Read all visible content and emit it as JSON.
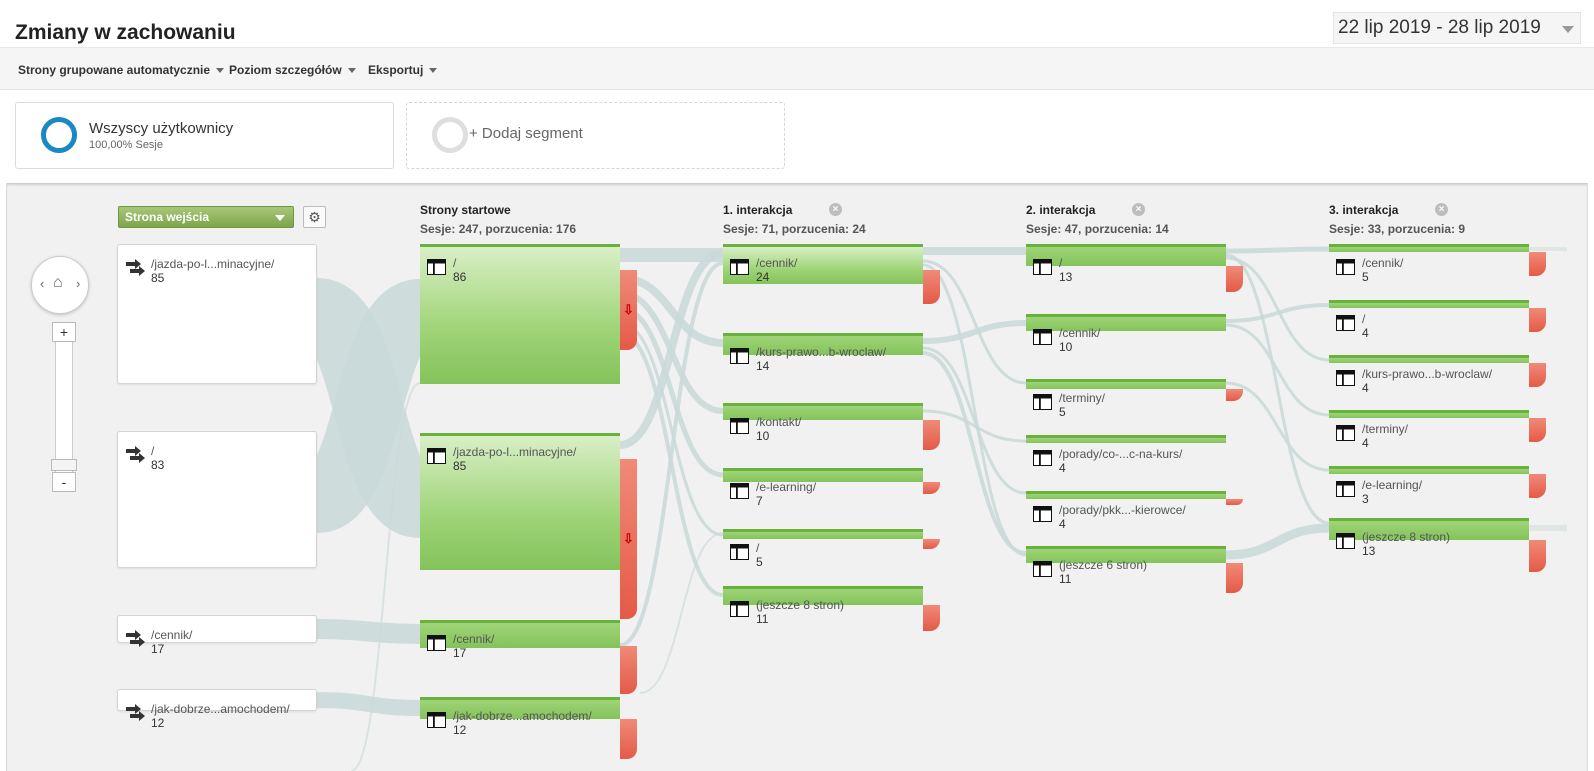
{
  "header": {
    "title": "Zmiany w zachowaniu",
    "date_range": "22 lip 2019 - 28 lip 2019"
  },
  "toolbar": {
    "items": [
      "Strony grupowane automatycznie",
      "Poziom szczegółów",
      "Eksportuj"
    ]
  },
  "segments": {
    "active": {
      "name": "Wszyscy użytkownicy",
      "sub": "100,00% Sesje",
      "color": "#1a88c4"
    },
    "add_label": "+ Dodaj segment"
  },
  "canvas": {
    "dimension_select": "Strona wejścia",
    "nav": {
      "left": "‹",
      "right": "›",
      "home": "⌂"
    },
    "zoom": {
      "plus": "+",
      "minus": "-"
    }
  },
  "columns": [
    {
      "title": "Strony startowe",
      "stats": "Sesje: 247, porzucenia: 176"
    },
    {
      "title": "1. interakcja",
      "stats": "Sesje: 71, porzucenia: 24"
    },
    {
      "title": "2. interakcja",
      "stats": "Sesje: 47, porzucenia: 14"
    },
    {
      "title": "3. interakcja",
      "stats": "Sesje: 33, porzucenia: 9"
    }
  ],
  "entry_nodes": [
    {
      "label": "/jazda-po-l...minacyjne/",
      "count": "85"
    },
    {
      "label": "/",
      "count": "83"
    },
    {
      "label": "/cennik/",
      "count": "17"
    },
    {
      "label": "/jak-dobrze...amochodem/",
      "count": "12"
    }
  ],
  "start_nodes": [
    {
      "label": "/",
      "count": "86"
    },
    {
      "label": "/jazda-po-l...minacyjne/",
      "count": "85"
    },
    {
      "label": "/cennik/",
      "count": "17"
    },
    {
      "label": "/jak-dobrze...amochodem/",
      "count": "12"
    }
  ],
  "step1_nodes": [
    {
      "label": "/cennik/",
      "count": "24"
    },
    {
      "label": "/kurs-prawo...b-wroclaw/",
      "count": "14"
    },
    {
      "label": "/kontakt/",
      "count": "10"
    },
    {
      "label": "/e-learning/",
      "count": "7"
    },
    {
      "label": "/",
      "count": "5"
    },
    {
      "label": "(jeszcze 8 stron)",
      "count": "11"
    }
  ],
  "step2_nodes": [
    {
      "label": "/",
      "count": "13"
    },
    {
      "label": "/cennik/",
      "count": "10"
    },
    {
      "label": "/terminy/",
      "count": "5"
    },
    {
      "label": "/porady/co-...c-na-kurs/",
      "count": "4"
    },
    {
      "label": "/porady/pkk...-kierowce/",
      "count": "4"
    },
    {
      "label": "(jeszcze 6 stron)",
      "count": "11"
    }
  ],
  "step3_nodes": [
    {
      "label": "/cennik/",
      "count": "5"
    },
    {
      "label": "/",
      "count": "4"
    },
    {
      "label": "/kurs-prawo...b-wroclaw/",
      "count": "4"
    },
    {
      "label": "/terminy/",
      "count": "4"
    },
    {
      "label": "/e-learning/",
      "count": "3"
    },
    {
      "label": "(jeszcze 8 stron)",
      "count": "13"
    }
  ],
  "colors": {
    "node_green": "#84c35a",
    "node_border": "#69b23c",
    "dropoff_red": "#e45a47",
    "flow_grey": "#c9d8d8"
  },
  "icons": {
    "entry": "entry-arrow-icon",
    "page": "page-layout-icon",
    "close": "close-circle-icon",
    "settings": "gear-icon"
  }
}
